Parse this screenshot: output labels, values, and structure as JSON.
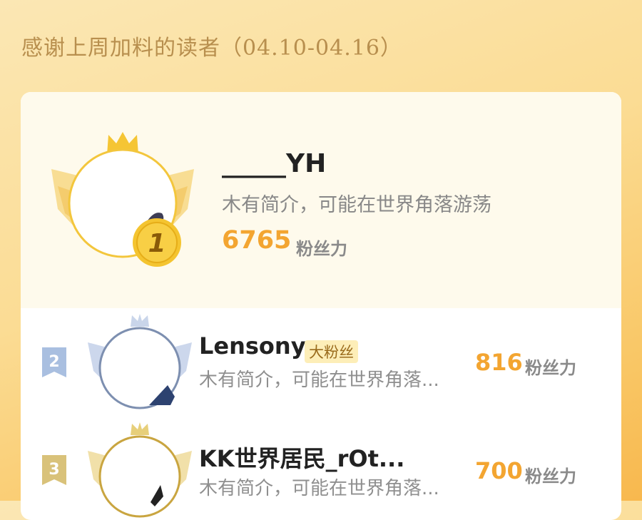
{
  "page": {
    "title": "感谢上周加料的读者（04.10-04.16）"
  },
  "top_reader": {
    "rank": "1",
    "name": "_____YH",
    "bio": "木有简介，可能在世界角落游荡",
    "score": "6765",
    "score_unit": "粉丝力"
  },
  "readers": [
    {
      "rank": "2",
      "name": "Lensony",
      "badge": "大粉丝",
      "bio": "木有简介，可能在世界角落...",
      "score": "816",
      "score_unit": "粉丝力"
    },
    {
      "rank": "3",
      "name": "KK世界居民_rOt...",
      "bio": "木有简介，可能在世界角落...",
      "score": "700",
      "score_unit": "粉丝力"
    }
  ],
  "colors": {
    "gold": "#f3a531",
    "silver_frame": "#7d8fb0",
    "bronze_frame": "#c9a540"
  }
}
